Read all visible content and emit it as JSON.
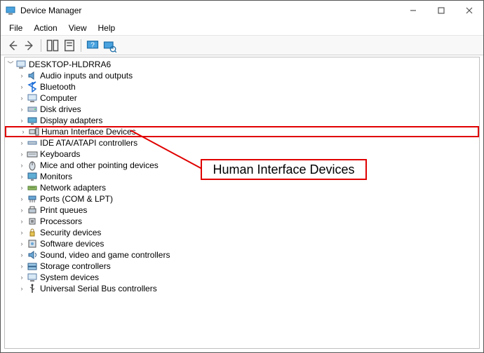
{
  "window": {
    "title": "Device Manager"
  },
  "menu": {
    "file": "File",
    "action": "Action",
    "view": "View",
    "help": "Help"
  },
  "annotation": {
    "label": "Human Interface Devices"
  },
  "tree": {
    "root": "DESKTOP-HLDRRA6",
    "items": [
      "Audio inputs and outputs",
      "Bluetooth",
      "Computer",
      "Disk drives",
      "Display adapters",
      "Human Interface Devices",
      "IDE ATA/ATAPI controllers",
      "Keyboards",
      "Mice and other pointing devices",
      "Monitors",
      "Network adapters",
      "Ports (COM & LPT)",
      "Print queues",
      "Processors",
      "Security devices",
      "Software devices",
      "Sound, video and game controllers",
      "Storage controllers",
      "System devices",
      "Universal Serial Bus controllers"
    ]
  }
}
